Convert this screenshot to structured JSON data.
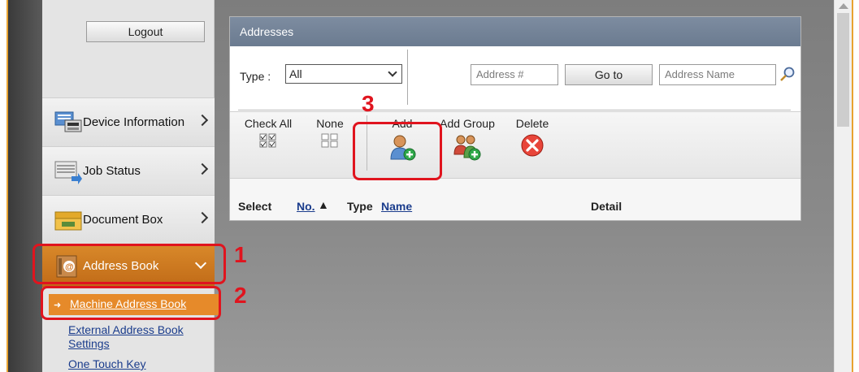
{
  "sidebar": {
    "logout_label": "Logout",
    "items": [
      {
        "label": "Device Information",
        "icon": "device-info-icon"
      },
      {
        "label": "Job Status",
        "icon": "job-status-icon"
      },
      {
        "label": "Document Box",
        "icon": "document-box-icon"
      },
      {
        "label": "Address Book",
        "icon": "address-book-icon",
        "expanded": true
      }
    ],
    "subitems": [
      {
        "label": "Machine Address Book",
        "selected": true
      },
      {
        "label": "External Address Book Settings"
      },
      {
        "label": "One Touch Key"
      }
    ]
  },
  "panel": {
    "title": "Addresses",
    "filter": {
      "type_label": "Type :",
      "type_value": "All",
      "address_number_placeholder": "Address #",
      "goto_label": "Go to",
      "address_name_placeholder": "Address Name"
    },
    "actions": {
      "check_all": "Check All",
      "none": "None",
      "add": "Add",
      "add_group": "Add Group",
      "delete": "Delete"
    },
    "columns": {
      "select": "Select",
      "no": "No.",
      "type": "Type",
      "name": "Name",
      "detail": "Detail"
    }
  },
  "callouts": [
    "1",
    "2",
    "3"
  ],
  "colors": {
    "accent_orange": "#e68a2a",
    "callout_red": "#e0141e",
    "header_blue_gray": "#74849a",
    "link_blue": "#1a3c8c"
  }
}
